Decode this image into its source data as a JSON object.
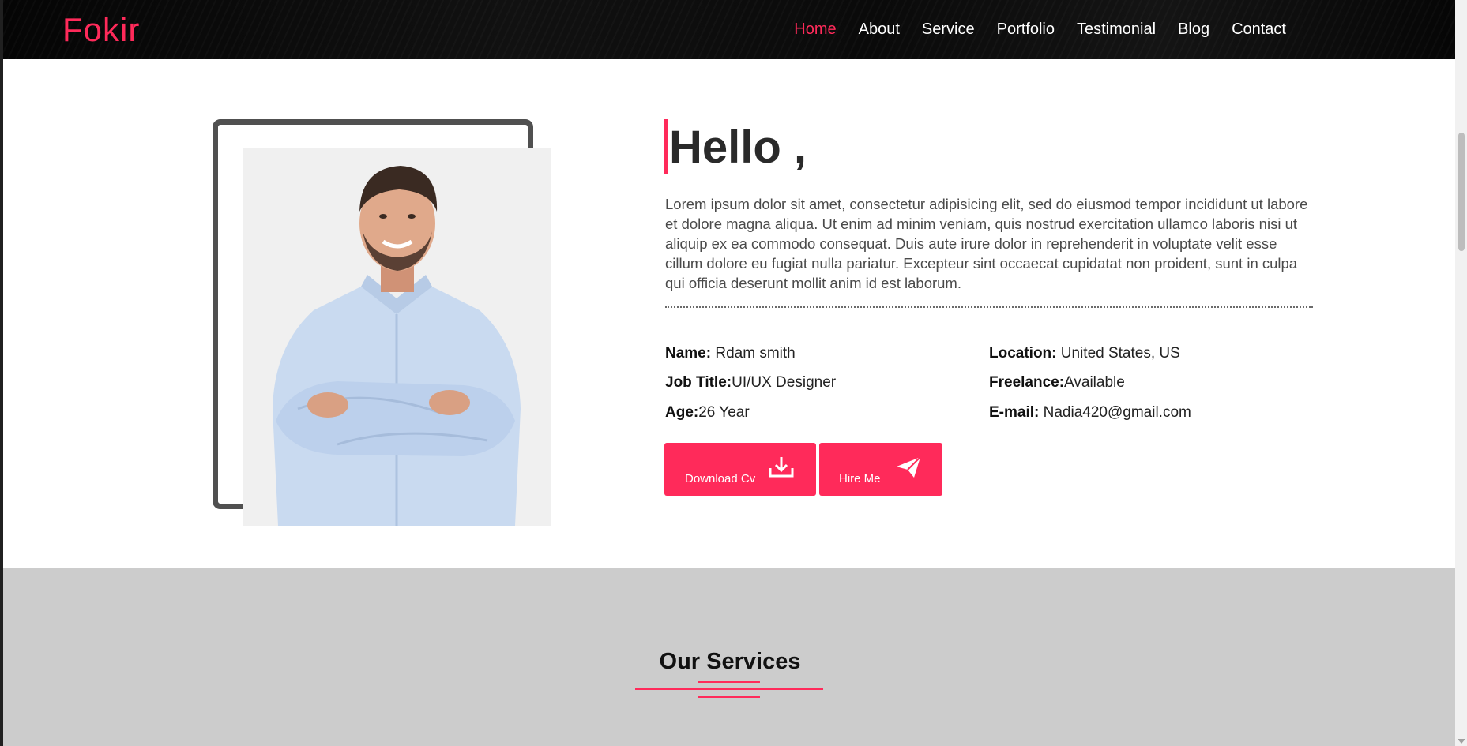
{
  "header": {
    "logo": "Fokir",
    "nav": [
      {
        "label": "Home",
        "active": true
      },
      {
        "label": "About",
        "active": false
      },
      {
        "label": "Service",
        "active": false
      },
      {
        "label": "Portfolio",
        "active": false
      },
      {
        "label": "Testimonial",
        "active": false
      },
      {
        "label": "Blog",
        "active": false
      },
      {
        "label": "Contact",
        "active": false
      }
    ]
  },
  "about": {
    "heading": "Hello ,",
    "intro": "Lorem ipsum dolor sit amet, consectetur adipisicing elit, sed do eiusmod tempor incididunt ut labore et dolore magna aliqua. Ut enim ad minim veniam, quis nostrud exercitation ullamco laboris nisi ut aliquip ex ea commodo consequat. Duis aute irure dolor in reprehenderit in voluptate velit esse cillum dolore eu fugiat nulla pariatur. Excepteur sint occaecat cupidatat non proident, sunt in culpa qui officia deserunt mollit anim id est laborum.",
    "details": {
      "name_label": "Name:",
      "name_value": " Rdam smith",
      "job_label": "Job Title:",
      "job_value": "UI/UX Designer",
      "age_label": "Age:",
      "age_value": "26 Year",
      "location_label": "Location:",
      "location_value": " United States, US",
      "freelance_label": "Freelance:",
      "freelance_value": "Available",
      "email_label": "E-mail:",
      "email_value": " Nadia420@gmail.com"
    },
    "buttons": {
      "download_cv": "Download Cv",
      "hire_me": "Hire Me"
    }
  },
  "services": {
    "title": "Our Services"
  },
  "colors": {
    "accent": "#ff2a5a",
    "header_bg": "#0a0a0a",
    "services_bg": "#cccccc",
    "frame": "#505050"
  },
  "icons": {
    "download": "download-icon",
    "send": "paper-plane-icon"
  }
}
